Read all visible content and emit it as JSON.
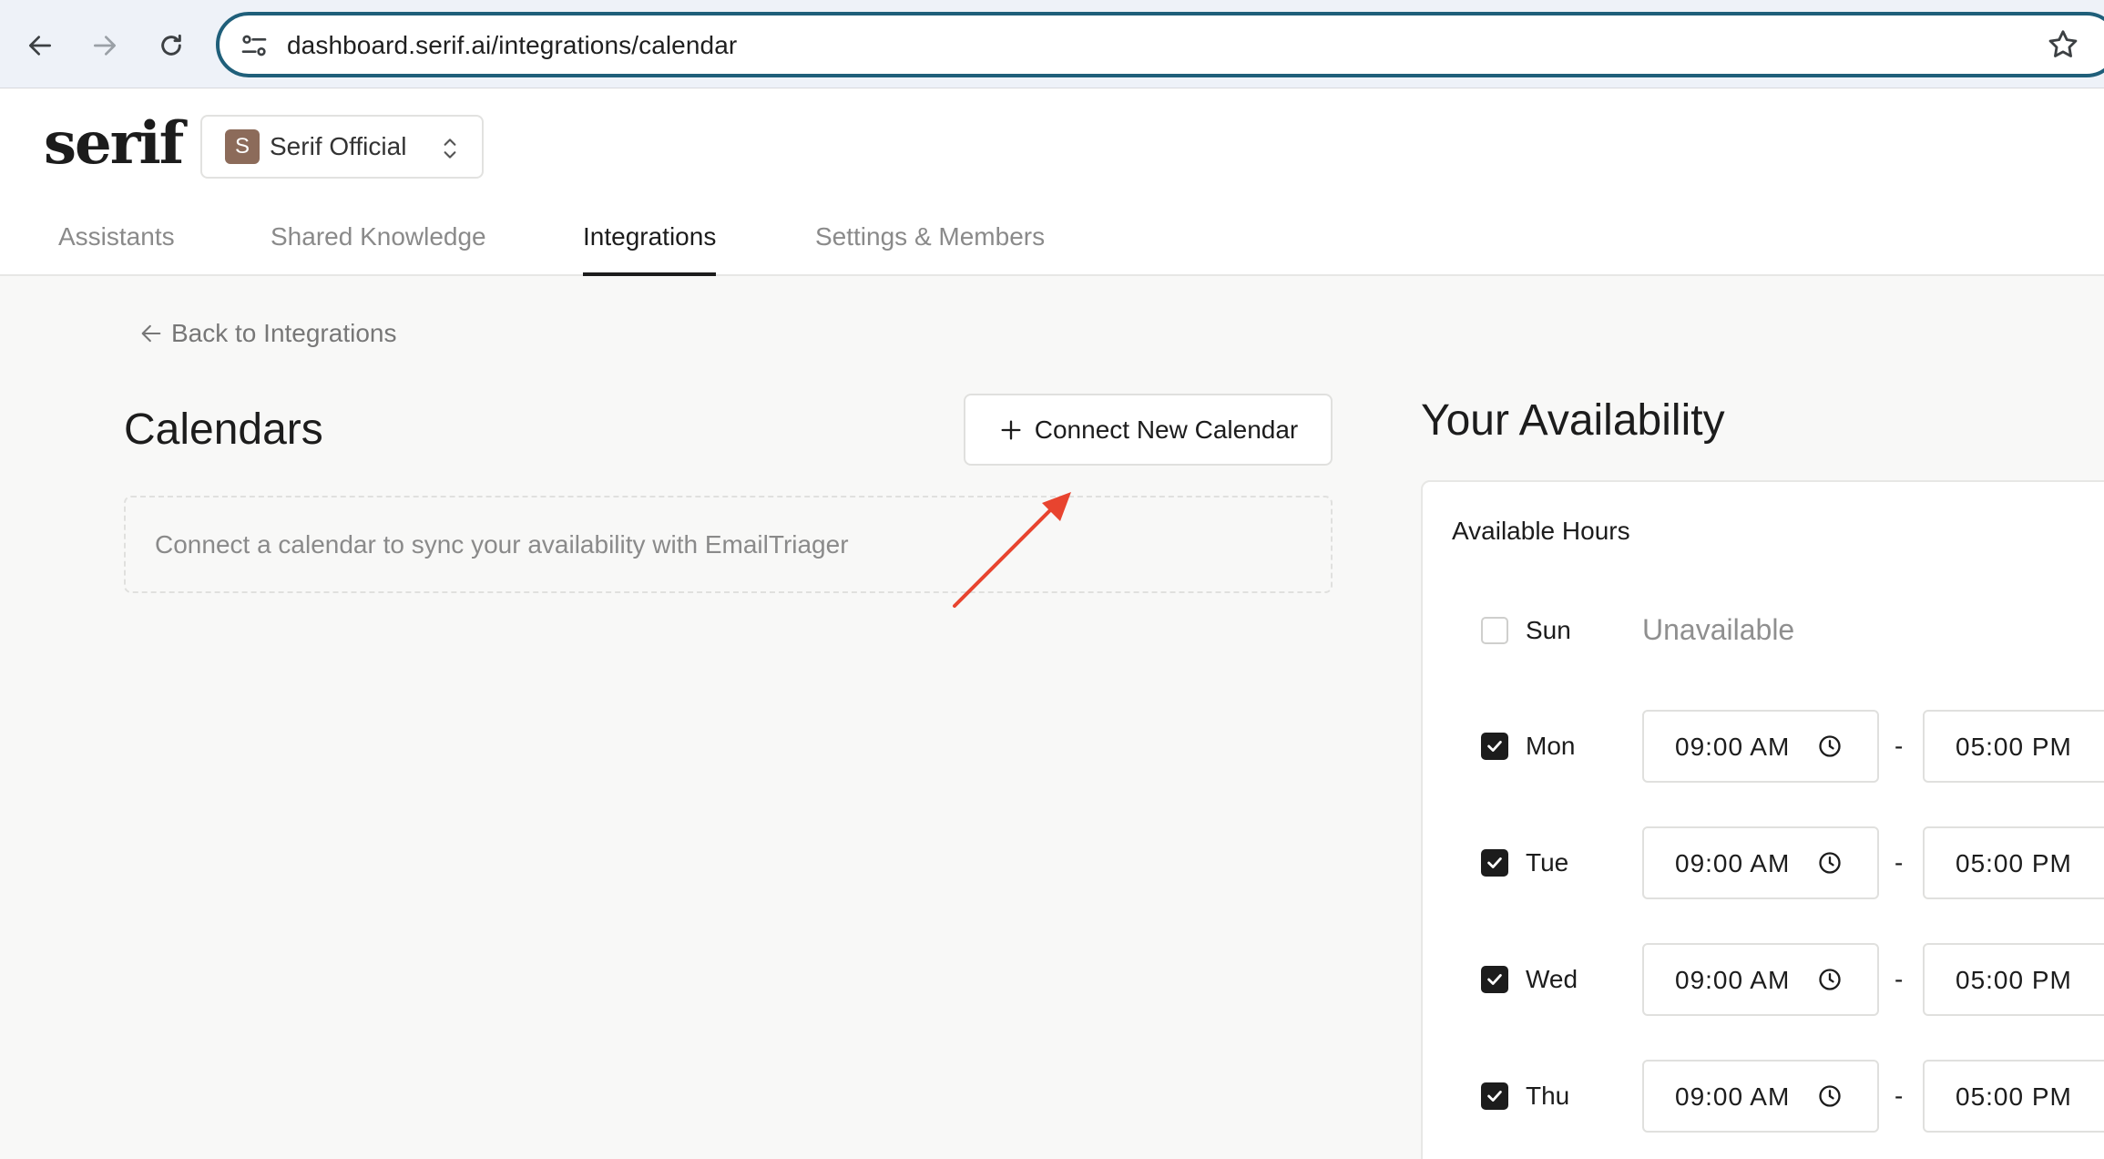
{
  "browser": {
    "url": "dashboard.serif.ai/integrations/calendar",
    "back_icon": "arrow-left-icon",
    "forward_icon": "arrow-right-icon",
    "reload_icon": "reload-icon",
    "bookmark_icon": "star-icon"
  },
  "app": {
    "logo": "serif",
    "org": {
      "initial": "S",
      "name": "Serif Official"
    },
    "tabs": [
      {
        "label": "Assistants",
        "active": false
      },
      {
        "label": "Shared Knowledge",
        "active": false
      },
      {
        "label": "Integrations",
        "active": true
      },
      {
        "label": "Settings & Members",
        "active": false
      }
    ]
  },
  "calendars": {
    "back_label": "Back to Integrations",
    "title": "Calendars",
    "connect_button": "Connect New Calendar",
    "empty_message": "Connect a calendar to sync your availability with EmailTriager"
  },
  "availability": {
    "title": "Your Availability",
    "section_label": "Available Hours",
    "unavailable_label": "Unavailable",
    "separator": "-",
    "days": [
      {
        "name": "Sun",
        "enabled": false,
        "start": "",
        "end": ""
      },
      {
        "name": "Mon",
        "enabled": true,
        "start": "09:00 AM",
        "end": "05:00 PM"
      },
      {
        "name": "Tue",
        "enabled": true,
        "start": "09:00 AM",
        "end": "05:00 PM"
      },
      {
        "name": "Wed",
        "enabled": true,
        "start": "09:00 AM",
        "end": "05:00 PM"
      },
      {
        "name": "Thu",
        "enabled": true,
        "start": "09:00 AM",
        "end": "05:00 PM"
      }
    ]
  },
  "colors": {
    "accent_border": "#1f5f7a",
    "annotation_arrow": "#e8442f",
    "org_avatar": "#8c6b5a"
  }
}
